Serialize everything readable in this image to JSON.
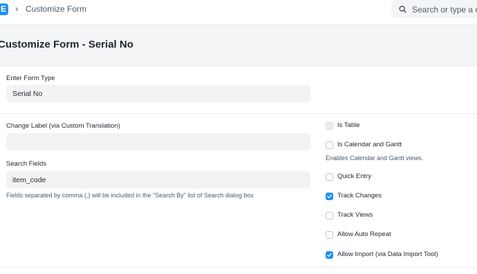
{
  "navbar": {
    "logo_letter": "E",
    "breadcrumb_sep": "›",
    "breadcrumb": "Customize Form",
    "search_placeholder": "Search or type a co"
  },
  "page": {
    "title": "Customize Form - Serial No"
  },
  "form": {
    "form_type_label": "Enter Form Type",
    "form_type_value": "Serial No",
    "change_label_label": "Change Label (via Custom Translation)",
    "change_label_value": "",
    "search_fields_label": "Search Fields",
    "search_fields_value": "item_code",
    "search_fields_help": "Fields separated by comma (,) will be included in the \"Search By\" list of Search dialog box"
  },
  "checkboxes": {
    "is_table": {
      "label": "Is Table",
      "checked": false,
      "disabled": true
    },
    "is_calendar": {
      "label": "Is Calendar and Gantt",
      "checked": false,
      "help": "Enables Calendar and Gantt views."
    },
    "quick_entry": {
      "label": "Quick Entry",
      "checked": false
    },
    "track_changes": {
      "label": "Track Changes",
      "checked": true
    },
    "track_views": {
      "label": "Track Views",
      "checked": false
    },
    "allow_auto_repeat": {
      "label": "Allow Auto Repeat",
      "checked": false
    },
    "allow_import": {
      "label": "Allow Import (via Data Import Tool)",
      "checked": true
    }
  },
  "colors": {
    "accent": "#2490ef",
    "background": "#f4f5f6"
  }
}
